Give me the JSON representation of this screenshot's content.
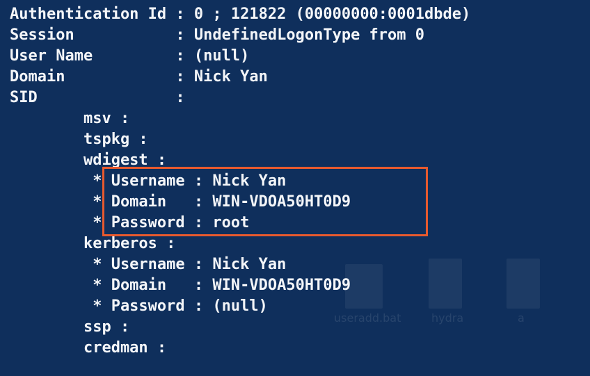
{
  "console": {
    "lines": [
      "Authentication Id : 0 ; 121822 (00000000:0001dbde)",
      "Session           : UndefinedLogonType from 0",
      "User Name         : (null)",
      "Domain            : Nick Yan",
      "SID               :",
      "        msv :",
      "        tspkg :",
      "        wdigest :",
      "         * Username : Nick Yan",
      "         * Domain   : WIN-VDOA50HT0D9",
      "         * Password : root",
      "        kerberos :",
      "         * Username : Nick Yan",
      "         * Domain   : WIN-VDOA50HT0D9",
      "         * Password : (null)",
      "        ssp :",
      "        credman :"
    ]
  },
  "desktop": {
    "labels": [
      "useradd.bat",
      "hydra",
      "a"
    ]
  },
  "colors": {
    "background": "#0f2f5c",
    "text": "#f3f5f8",
    "highlight": "#e85a2e"
  }
}
